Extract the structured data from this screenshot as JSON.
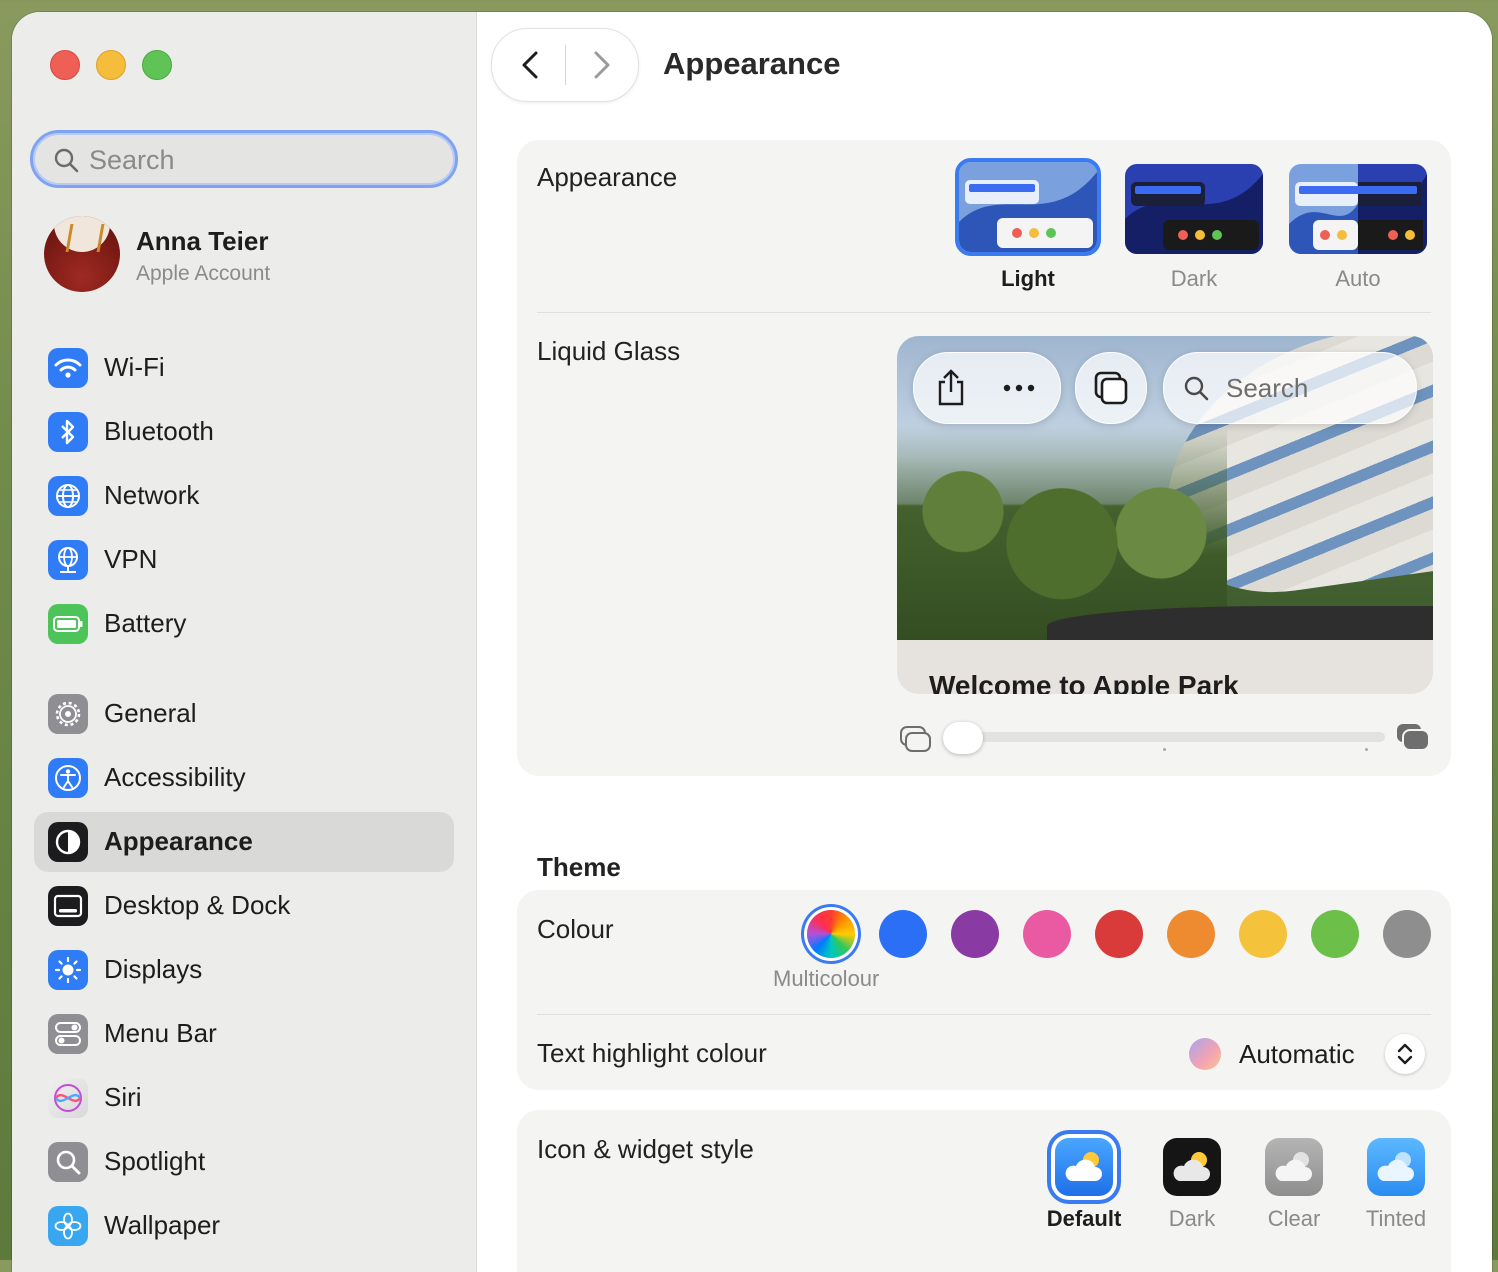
{
  "sidebar": {
    "search": {
      "placeholder": "Search"
    },
    "account": {
      "name": "Anna Teier",
      "subtitle": "Apple Account"
    },
    "items": [
      {
        "label": "Wi-Fi",
        "icon": "wifi-icon",
        "color": "#2f7cf6"
      },
      {
        "label": "Bluetooth",
        "icon": "bluetooth-icon",
        "color": "#2f7cf6"
      },
      {
        "label": "Network",
        "icon": "globe-icon",
        "color": "#2f7cf6"
      },
      {
        "label": "VPN",
        "icon": "vpn-globe-icon",
        "color": "#2f7cf6"
      },
      {
        "label": "Battery",
        "icon": "battery-icon",
        "color": "#4cc45a"
      },
      {
        "label": "General",
        "icon": "gear-icon",
        "color": "#8e8e93"
      },
      {
        "label": "Accessibility",
        "icon": "accessibility-icon",
        "color": "#2f7cf6"
      },
      {
        "label": "Appearance",
        "icon": "appearance-icon",
        "color": "#1c1c1e",
        "active": true
      },
      {
        "label": "Desktop & Dock",
        "icon": "dock-icon",
        "color": "#1c1c1e"
      },
      {
        "label": "Displays",
        "icon": "sun-icon",
        "color": "#2f7cf6"
      },
      {
        "label": "Menu Bar",
        "icon": "toggles-icon",
        "color": "#8e8e93"
      },
      {
        "label": "Siri",
        "icon": "siri-icon",
        "color": "#d9d9d9"
      },
      {
        "label": "Spotlight",
        "icon": "magnifier-icon",
        "color": "#8e8e93"
      },
      {
        "label": "Wallpaper",
        "icon": "flower-icon",
        "color": "#38a7f0"
      }
    ]
  },
  "main": {
    "title": "Appearance",
    "appearance": {
      "label": "Appearance",
      "options": [
        {
          "label": "Light",
          "selected": true
        },
        {
          "label": "Dark",
          "selected": false
        },
        {
          "label": "Auto",
          "selected": false
        }
      ]
    },
    "liquid_glass": {
      "label": "Liquid Glass",
      "preview": {
        "search_placeholder": "Search",
        "caption": "Welcome to Apple Park"
      },
      "slider_value": 0
    },
    "theme": {
      "title": "Theme",
      "colour": {
        "label": "Colour",
        "selected_label": "Multicolour",
        "swatches": [
          "multicolour",
          "#2a6ff5",
          "#8a3aa3",
          "#e95aa2",
          "#d93a3a",
          "#ee8a30",
          "#f5c23c",
          "#6cc04a",
          "#8e8e8e"
        ]
      },
      "highlight": {
        "label": "Text highlight colour",
        "value": "Automatic"
      }
    },
    "icon_style": {
      "label": "Icon & widget style",
      "options": [
        {
          "label": "Default",
          "selected": true
        },
        {
          "label": "Dark",
          "selected": false
        },
        {
          "label": "Clear",
          "selected": false
        },
        {
          "label": "Tinted",
          "selected": false
        }
      ]
    }
  }
}
